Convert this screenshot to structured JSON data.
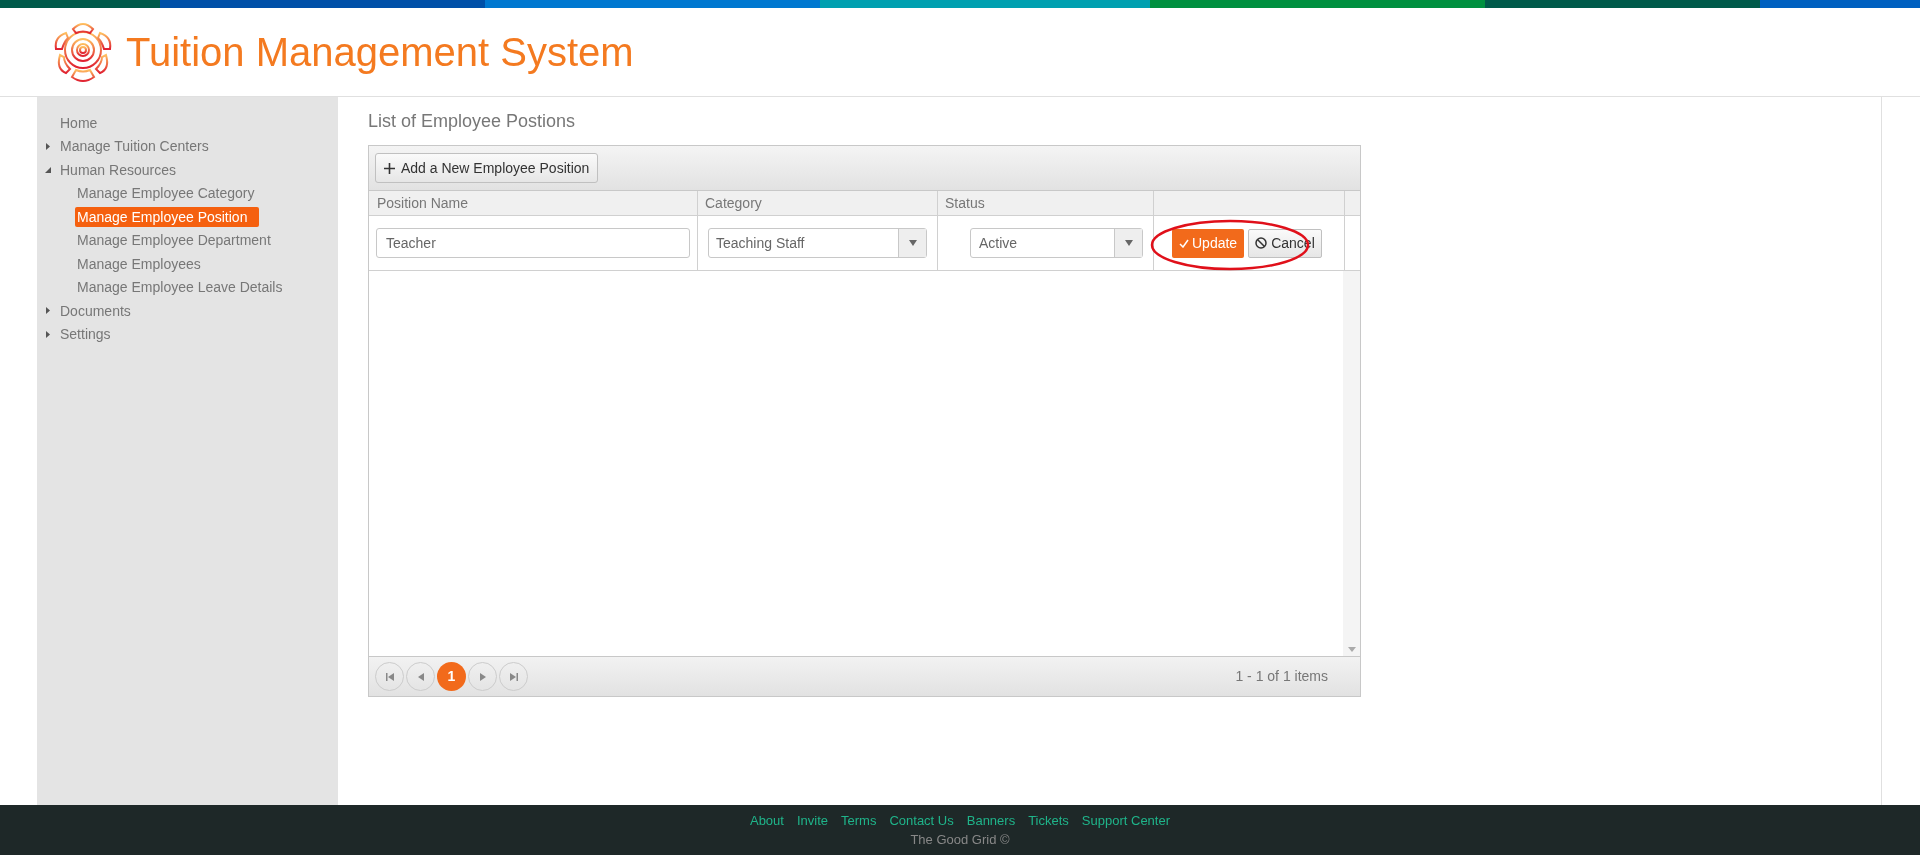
{
  "header": {
    "title": "Tuition Management System"
  },
  "sidebar": {
    "items": [
      {
        "label": "Home",
        "selected": false
      },
      {
        "label": "Manage Tuition Centers",
        "selected": false,
        "expanded": false
      },
      {
        "label": "Human Resources",
        "selected": false,
        "expanded": true,
        "children": [
          {
            "label": "Manage Employee Category",
            "selected": false
          },
          {
            "label": "Manage Employee Position",
            "selected": true
          },
          {
            "label": "Manage Employee Department",
            "selected": false
          },
          {
            "label": "Manage Employees",
            "selected": false
          },
          {
            "label": "Manage Employee Leave Details",
            "selected": false
          }
        ]
      },
      {
        "label": "Documents",
        "selected": false,
        "expanded": false
      },
      {
        "label": "Settings",
        "selected": false,
        "expanded": false
      }
    ]
  },
  "page_title": "List of Employee Postions",
  "grid": {
    "toolbar_button": "Add a New Employee Position",
    "columns": [
      "Position Name",
      "Category",
      "Status"
    ],
    "edit_row": {
      "position_name": "Teacher",
      "category": "Teaching Staff",
      "status": "Active",
      "update_button": "Update",
      "cancel_button": "Cancel"
    },
    "pager": {
      "pages": [
        {
          "label": "1",
          "selected": true
        }
      ],
      "info": "1 - 1 of 1 items"
    }
  },
  "footer": {
    "links": [
      "About",
      "Invite",
      "Terms",
      "Contact Us",
      "Banners",
      "Tickets",
      "Support Center"
    ],
    "copyright": "The Good Grid ©"
  }
}
